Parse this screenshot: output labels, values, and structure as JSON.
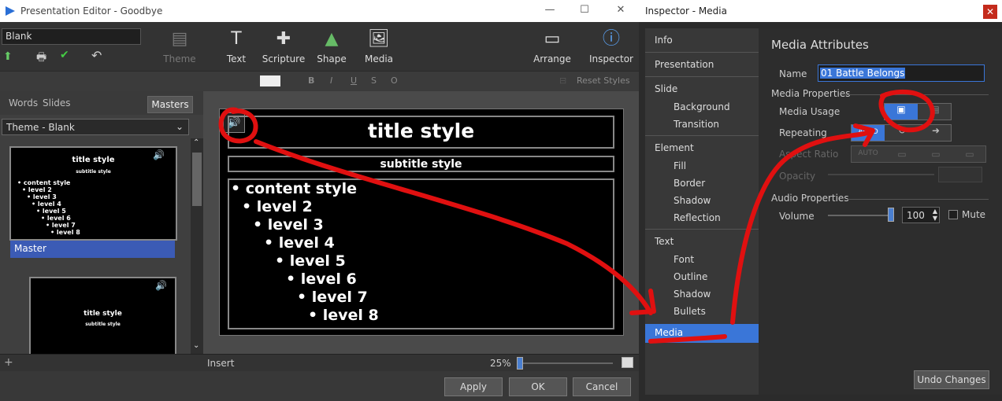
{
  "editor": {
    "title": "Presentation Editor - Goodbye",
    "blank_value": "Blank",
    "tools": {
      "theme": "Theme",
      "text": "Text",
      "scripture": "Scripture",
      "shape": "Shape",
      "media": "Media",
      "arrange": "Arrange",
      "inspector": "Inspector"
    },
    "format_bar": {
      "reset_styles": "Reset Styles",
      "bold": "B",
      "italic": "I",
      "underline": "U",
      "strike": "S",
      "outline": "O"
    },
    "left_tabs": {
      "words": "Words",
      "slides": "Slides",
      "masters": "Masters"
    },
    "theme_select": "Theme - Blank",
    "thumb1": {
      "title": "title style",
      "subtitle": "subtitle style",
      "levels": [
        "• content style",
        "• level 2",
        "• level 3",
        "• level 4",
        "• level 5",
        "• level 6",
        "• level 7",
        "• level 8"
      ],
      "label": "Master"
    },
    "thumb2": {
      "title": "title style",
      "subtitle": "subtitle style"
    },
    "slide": {
      "title": "title style",
      "subtitle": "subtitle style",
      "levels": [
        "• content style",
        "• level 2",
        "• level 3",
        "• level 4",
        "• level 5",
        "• level 6",
        "• level 7",
        "• level 8"
      ]
    },
    "status": {
      "mode": "Insert",
      "zoom": "25%",
      "add": "+"
    },
    "buttons": {
      "apply": "Apply",
      "ok": "OK",
      "cancel": "Cancel"
    }
  },
  "inspector": {
    "title": "Inspector - Media",
    "close": "✕",
    "nav": {
      "info": "Info",
      "presentation": "Presentation",
      "slide": "Slide",
      "background": "Background",
      "transition": "Transition",
      "element": "Element",
      "fill": "Fill",
      "border": "Border",
      "shadow": "Shadow",
      "reflection": "Reflection",
      "text": "Text",
      "font": "Font",
      "outline": "Outline",
      "text_shadow": "Shadow",
      "bullets": "Bullets",
      "media": "Media"
    },
    "heading": "Media Attributes",
    "name_label": "Name",
    "name_value": "01 Battle Belongs",
    "media_properties": "Media Properties",
    "media_usage": "Media Usage",
    "repeating": "Repeating",
    "repeat_auto": "AUTO",
    "aspect_ratio": "Aspect Ratio",
    "aspect_auto": "AUTO",
    "opacity": "Opacity",
    "audio_properties": "Audio Properties",
    "volume": "Volume",
    "volume_value": "100",
    "volume_level": 1.0,
    "mute": "Mute",
    "undo": "Undo Changes"
  },
  "colors": {
    "accent": "#3a76d8",
    "annotation": "#e01010"
  }
}
